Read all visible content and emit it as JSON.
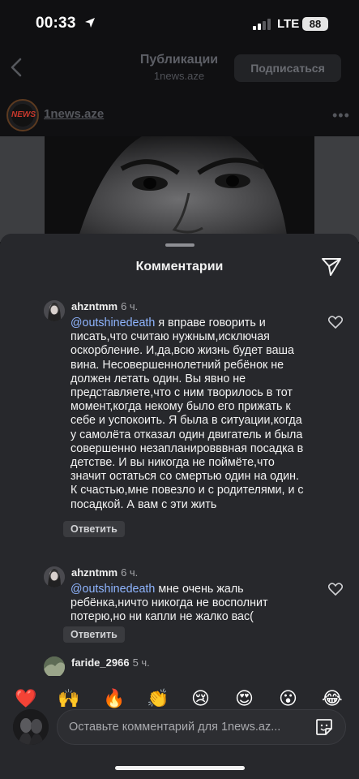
{
  "status": {
    "time": "00:33",
    "network": "LTE",
    "battery": "88"
  },
  "header": {
    "title": "Публикации",
    "subtitle": "1news.aze",
    "follow_label": "Подписаться"
  },
  "post": {
    "username": "1news.aze",
    "avatar_text": "NEWS"
  },
  "comments_sheet": {
    "title": "Комментарии",
    "comments": [
      {
        "username": "ahzntmm",
        "time": "6 ч.",
        "mention": "@outshinedeath",
        "text": " я вправе говорить и писать,что считаю нужным,исключая оскорбление. И,да,всю жизнь будет ваша вина. Несовершеннолетний ребёнок не должен летать один. Вы явно не представляете,что с ним творилось в тот момент,когда некому было его прижать к себе и успокоить. Я была в ситуации,когда у самолёта отказал один двигатель и была совершенно незапланировввная посадка в детстве. И вы никогда не поймёте,что значит остаться со смертью один на один. К счастью,мне повезло и с родителями, и с посадкой. А вам с эти жить",
        "reply_label": "Ответить"
      },
      {
        "username": "ahzntmm",
        "time": "6 ч.",
        "mention": "@outshinedeath",
        "text": " мне очень жаль ребёнка,ничто никогда не восполнит потерю,но ни капли не жалко вас(",
        "reply_label": "Ответить"
      },
      {
        "username": "faride_2966",
        "time": "5 ч."
      }
    ]
  },
  "emoji_bar": [
    "❤️",
    "🙌",
    "🔥",
    "👏",
    "😢",
    "😍",
    "😮",
    "😂"
  ],
  "input": {
    "placeholder": "Оставьте комментарий для 1news.az..."
  },
  "colors": {
    "sheet_bg": "#27282c",
    "mention": "#8fb5ff",
    "page_bg": "#101012"
  }
}
